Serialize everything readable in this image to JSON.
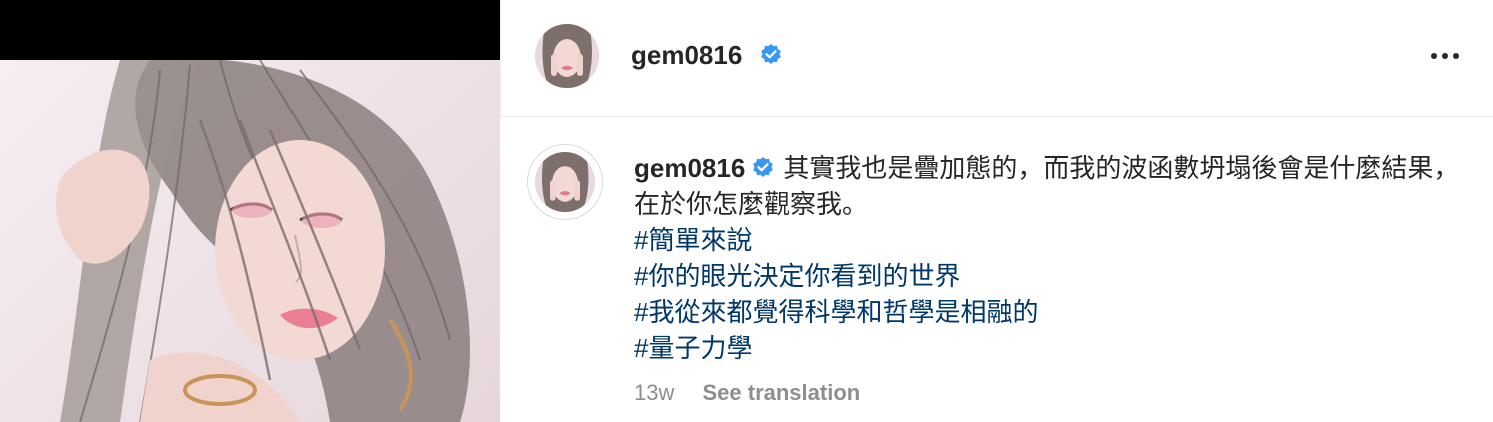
{
  "post": {
    "username": "gem0816",
    "verified": true,
    "more_icon": "more-horizontal-icon",
    "verified_icon": "verified-badge-icon"
  },
  "caption": {
    "username": "gem0816",
    "text": "其實我也是疊加態的，而我的波函數坍塌後會是什麼結果，在於你怎麼觀察我。",
    "hashtags": [
      "#簡單來說",
      "#你的眼光決定你看到的世界",
      "#我從來都覺得科學和哲學是相融的",
      "#量子力學"
    ]
  },
  "meta": {
    "timestamp": "13w",
    "see_translation": "See translation"
  },
  "colors": {
    "hashtag": "#00376b",
    "verified": "#3897f0",
    "muted": "#8e8e8e",
    "text": "#262626"
  }
}
